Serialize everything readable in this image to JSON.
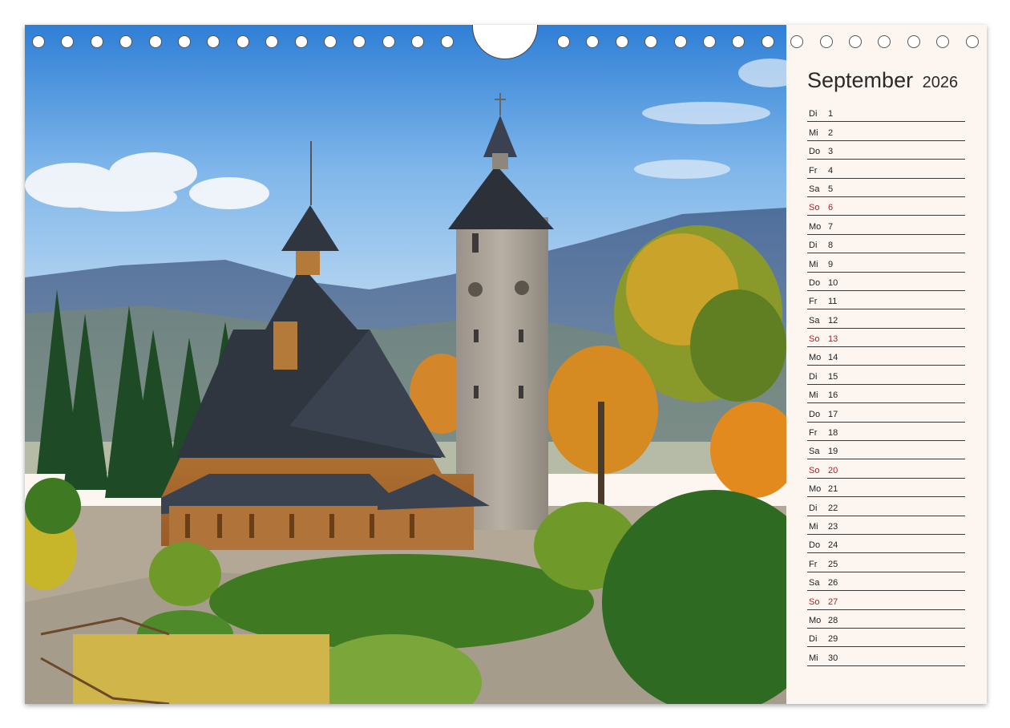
{
  "calendar": {
    "month": "September",
    "year": "2026",
    "days": [
      {
        "dow": "Di",
        "day": "1",
        "sunday": false
      },
      {
        "dow": "Mi",
        "day": "2",
        "sunday": false
      },
      {
        "dow": "Do",
        "day": "3",
        "sunday": false
      },
      {
        "dow": "Fr",
        "day": "4",
        "sunday": false
      },
      {
        "dow": "Sa",
        "day": "5",
        "sunday": false
      },
      {
        "dow": "So",
        "day": "6",
        "sunday": true
      },
      {
        "dow": "Mo",
        "day": "7",
        "sunday": false
      },
      {
        "dow": "Di",
        "day": "8",
        "sunday": false
      },
      {
        "dow": "Mi",
        "day": "9",
        "sunday": false
      },
      {
        "dow": "Do",
        "day": "10",
        "sunday": false
      },
      {
        "dow": "Fr",
        "day": "11",
        "sunday": false
      },
      {
        "dow": "Sa",
        "day": "12",
        "sunday": false
      },
      {
        "dow": "So",
        "day": "13",
        "sunday": true
      },
      {
        "dow": "Mo",
        "day": "14",
        "sunday": false
      },
      {
        "dow": "Di",
        "day": "15",
        "sunday": false
      },
      {
        "dow": "Mi",
        "day": "16",
        "sunday": false
      },
      {
        "dow": "Do",
        "day": "17",
        "sunday": false
      },
      {
        "dow": "Fr",
        "day": "18",
        "sunday": false
      },
      {
        "dow": "Sa",
        "day": "19",
        "sunday": false
      },
      {
        "dow": "So",
        "day": "20",
        "sunday": true
      },
      {
        "dow": "Mo",
        "day": "21",
        "sunday": false
      },
      {
        "dow": "Di",
        "day": "22",
        "sunday": false
      },
      {
        "dow": "Mi",
        "day": "23",
        "sunday": false
      },
      {
        "dow": "Do",
        "day": "24",
        "sunday": false
      },
      {
        "dow": "Fr",
        "day": "25",
        "sunday": false
      },
      {
        "dow": "Sa",
        "day": "26",
        "sunday": false
      },
      {
        "dow": "So",
        "day": "27",
        "sunday": true
      },
      {
        "dow": "Mo",
        "day": "28",
        "sunday": false
      },
      {
        "dow": "Di",
        "day": "29",
        "sunday": false
      },
      {
        "dow": "Mi",
        "day": "30",
        "sunday": false
      }
    ]
  },
  "colors": {
    "sunday_red": "#b02028",
    "panel_bg": "#fdf5ef",
    "sky_top": "#2f7fd6"
  },
  "photo": {
    "icon": "stave-church-landscape-photo"
  }
}
